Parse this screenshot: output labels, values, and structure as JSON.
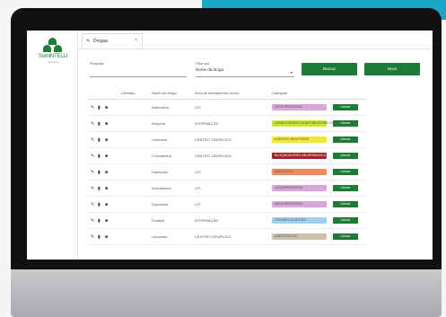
{
  "tab": {
    "label": "Drogas",
    "close": "×"
  },
  "brand": {
    "name": "SomINTELLI",
    "subtitle": "Sistemas"
  },
  "filters": {
    "search_label": "Pesquisar",
    "search_value": "",
    "filter_label": "Filtrar por",
    "filter_value": "Nome da droga",
    "search_button": "Buscar",
    "new_button": "Novo"
  },
  "table": {
    "headers": [
      "Liberado",
      "Nome da droga",
      "Área de atendimento clínico",
      "Categoria"
    ],
    "rows": [
      {
        "name": "Adenosina",
        "area": "UTI",
        "category": "VASOPRESSORES",
        "color": "#d9a6d9",
        "action": "Liberar"
      },
      {
        "name": "Atropina",
        "area": "INTERNAÇÃO",
        "category": "QUIMIOTERÁPICOS ANTINEOPLÁSICOS",
        "color": "#c9e33a",
        "action": "Liberar"
      },
      {
        "name": "Cetamina",
        "area": "CENTRO CIRÚRGICO",
        "category": "AGENTES INDUTORES",
        "color": "#f0ea2a",
        "action": "Liberar"
      },
      {
        "name": "Cl.Ketamina",
        "area": "CENTRO CIRÚRGICO",
        "category": "BLOQUEADORES NEUROMUSCULARES",
        "color": "#a32222",
        "action": "Liberar"
      },
      {
        "name": "Diazepam",
        "area": "UTI",
        "category": "SEDATIVOS",
        "color": "#ee8a5e",
        "action": "Liberar"
      },
      {
        "name": "Dobutamina",
        "area": "UTI",
        "category": "VASOPRESSORES",
        "color": "#d9a6d9",
        "action": "Liberar"
      },
      {
        "name": "Dopamina",
        "area": "UTI",
        "category": "VASOPRESSORES",
        "color": "#d9a6d9",
        "action": "Liberar"
      },
      {
        "name": "Fentanil",
        "area": "INTERNAÇÃO",
        "category": "OPIOIDES AGENTES",
        "color": "#9fd0ef",
        "action": "Liberar"
      },
      {
        "name": "Lidocaína",
        "area": "CENTRO CIRÚRGICO",
        "category": "ANESTÉSICOS",
        "color": "#cdbfae",
        "action": "Liberar"
      }
    ]
  }
}
